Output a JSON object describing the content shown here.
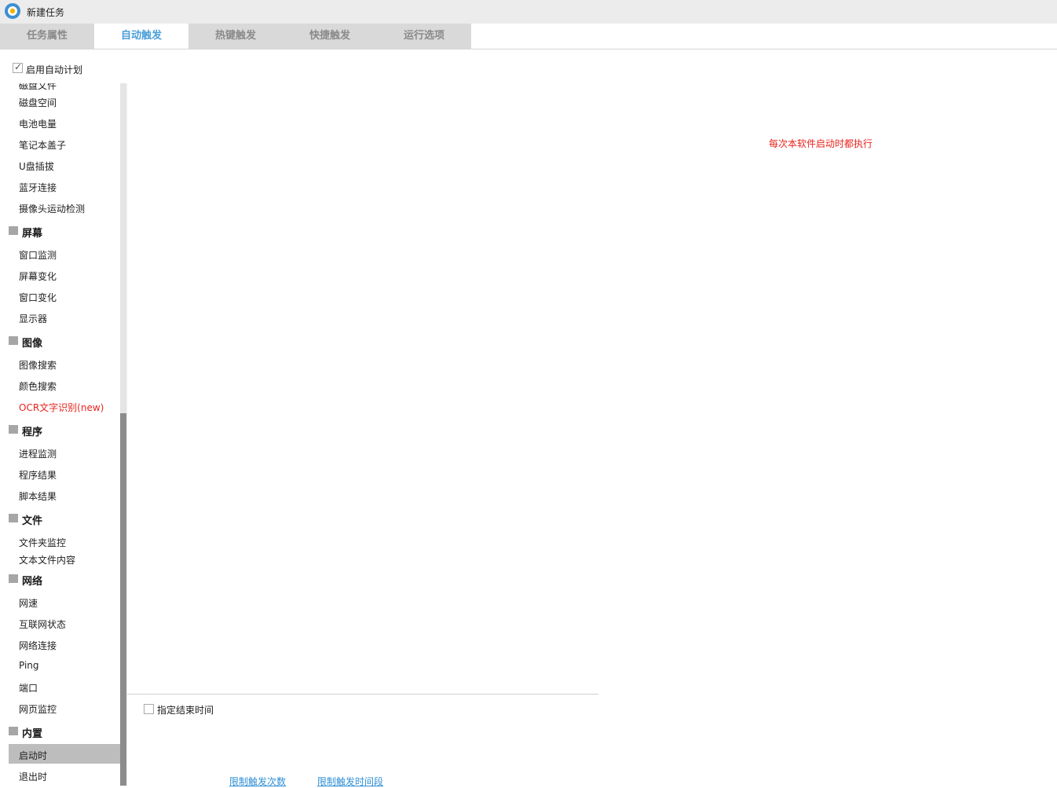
{
  "window": {
    "title": "新建任务",
    "icon": "gear-app-icon"
  },
  "tabs": [
    {
      "label": "任务属性",
      "active": false
    },
    {
      "label": "自动触发",
      "active": true
    },
    {
      "label": "热键触发",
      "active": false
    },
    {
      "label": "快捷触发",
      "active": false
    },
    {
      "label": "运行选项",
      "active": false
    }
  ],
  "enable_schedule": {
    "label": "启用自动计划",
    "checked": true
  },
  "sidebar": {
    "clipped_top": "磁盘文件",
    "groups": [
      {
        "name": "",
        "items": [
          "磁盘空间",
          "电池电量",
          "笔记本盖子",
          "U盘插拔",
          "蓝牙连接",
          "摄像头运动检测"
        ]
      },
      {
        "name": "屏幕",
        "items": [
          "窗口监测",
          "屏幕变化",
          "窗口变化",
          "显示器"
        ]
      },
      {
        "name": "图像",
        "items": [
          "图像搜索",
          "颜色搜索",
          "OCR文字识别(new)"
        ]
      },
      {
        "name": "程序",
        "items": [
          "进程监测",
          "程序结果",
          "脚本结果"
        ]
      },
      {
        "name": "文件",
        "items": [
          "文件夹监控",
          "文本文件内容"
        ]
      },
      {
        "name": "网络",
        "items": [
          "网速",
          "互联网状态",
          "网络连接",
          "Ping",
          "端口",
          "网页监控"
        ]
      },
      {
        "name": "内置",
        "items": [
          "启动时",
          "退出时"
        ]
      }
    ],
    "selected": "启动时",
    "highlight_color": "#e8231e"
  },
  "main": {
    "hint": "每次本软件启动时都执行",
    "end_time": {
      "label": "指定结束时间",
      "checked": false
    },
    "links": {
      "limit_count": "限制触发次数",
      "limit_period": "限制触发时间段"
    }
  },
  "colors": {
    "accent": "#4a9fd8",
    "warning": "#e8231e",
    "link": "#2f8fd6"
  }
}
